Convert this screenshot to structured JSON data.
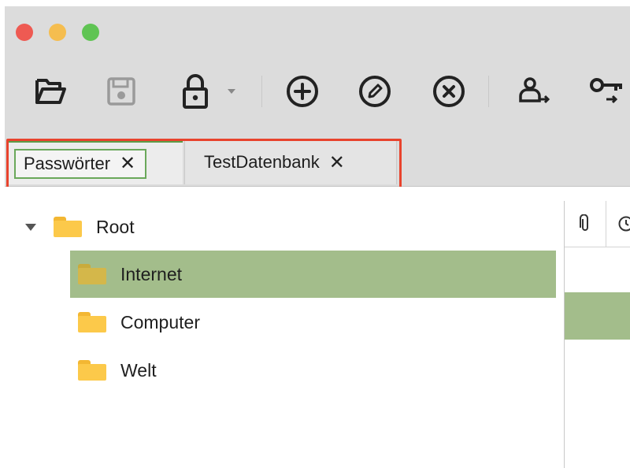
{
  "colors": {
    "close": "#ee5a52",
    "minimize": "#f5bd4f",
    "zoom": "#5fc453",
    "accent": "#5d9b47",
    "selection": "#a3bd8b",
    "folder": "#fcc94a",
    "highlight": "#e8432d"
  },
  "toolbar": {
    "buttons": [
      {
        "icon": "open-folder-icon"
      },
      {
        "icon": "save-icon"
      },
      {
        "icon": "lock-icon"
      },
      {
        "icon": "dropdown-arrow-icon"
      },
      {
        "icon": "add-circle-icon"
      },
      {
        "icon": "edit-circle-icon"
      },
      {
        "icon": "delete-circle-icon"
      },
      {
        "icon": "copy-username-icon"
      },
      {
        "icon": "copy-password-icon"
      }
    ]
  },
  "tabs": [
    {
      "label": "Passwörter",
      "close": "✕",
      "active": true
    },
    {
      "label": "TestDatenbank",
      "close": "✕",
      "active": false
    }
  ],
  "tree": {
    "root": {
      "label": "Root",
      "expanded": true
    },
    "children": [
      {
        "label": "Internet",
        "selected": true
      },
      {
        "label": "Computer",
        "selected": false
      },
      {
        "label": "Welt",
        "selected": false
      }
    ]
  },
  "entry_table": {
    "columns": [
      {
        "icon": "attachment-icon"
      },
      {
        "icon": "clock-icon"
      }
    ]
  }
}
